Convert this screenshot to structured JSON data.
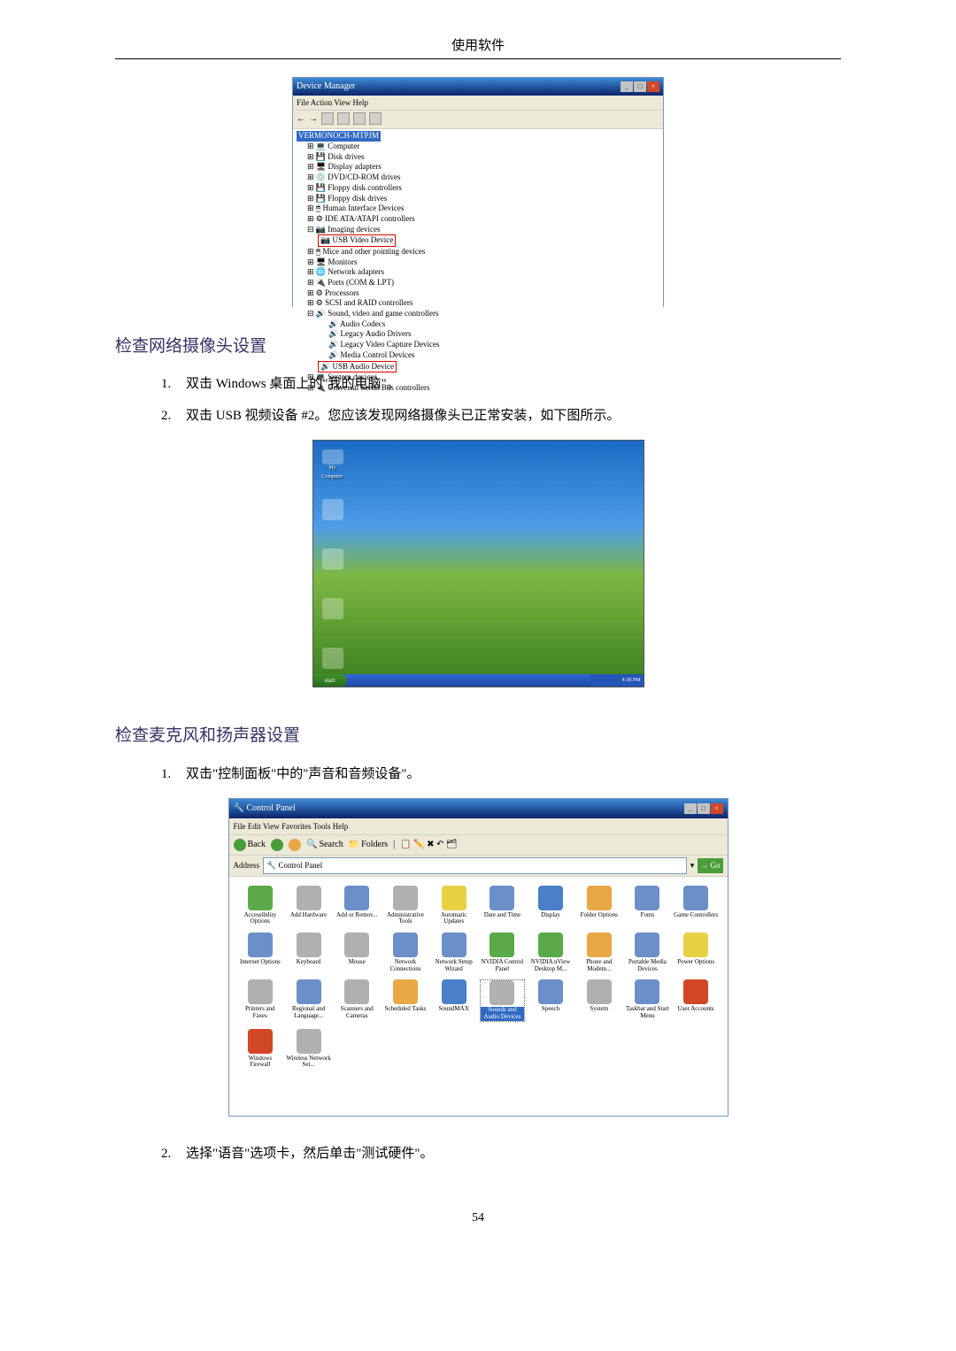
{
  "page_header": "使用软件",
  "page_number": "54",
  "device_manager": {
    "title": "Device Manager",
    "menu": "File   Action   View   Help",
    "tree_root": "VERMONOCH-MTPJM",
    "tree_items": [
      "Computer",
      "Disk drives",
      "Display adapters",
      "DVD/CD-ROM drives",
      "Floppy disk controllers",
      "Floppy disk drives",
      "Human Interface Devices",
      "IDE ATA/ATAPI controllers",
      "Imaging devices"
    ],
    "highlight1": "USB Video Device",
    "tree_items2": [
      "Mice and other pointing devices",
      "Monitors",
      "Network adapters",
      "Ports (COM & LPT)",
      "Processors",
      "SCSI and RAID controllers",
      "Sound, video and game controllers"
    ],
    "sound_sub": [
      "Audio Codecs",
      "Legacy Audio Drivers",
      "Legacy Video Capture Devices",
      "Media Control Devices"
    ],
    "highlight2": "USB Audio Device",
    "tree_items3": [
      "System devices",
      "Universal Serial Bus controllers"
    ]
  },
  "section1_heading": "检查网络摄像头设置",
  "section1_steps": [
    {
      "num": "1.",
      "text": "双击 Windows 桌面上的\"我的电脑\"。"
    },
    {
      "num": "2.",
      "text": "双击 USB 视频设备 #2。您应该发现网络摄像头已正常安装，如下图所示。"
    }
  ],
  "desktop": {
    "icons": [
      "My Computer",
      "",
      "",
      "",
      "",
      ""
    ],
    "start": "start",
    "time": "4:38 PM"
  },
  "section2_heading": "检查麦克风和扬声器设置",
  "section2_steps": [
    {
      "num": "1.",
      "text": "双击\"控制面板\"中的\"声音和音频设备\"。"
    },
    {
      "num": "2.",
      "text": "选择\"语音\"选项卡，然后单击\"测试硬件\"。"
    }
  ],
  "control_panel": {
    "title": "Control Panel",
    "menu": "File   Edit   View   Favorites   Tools   Help",
    "back": "Back",
    "search": "Search",
    "folders": "Folders",
    "address_label": "Address",
    "address_value": "Control Panel",
    "go": "Go",
    "items": [
      "Accessibility Options",
      "Add Hardware",
      "Add or Remov...",
      "Administrative Tools",
      "Automatic Updates",
      "Date and Time",
      "Display",
      "Folder Options",
      "Fonts",
      "Game Controllers",
      "Internet Options",
      "Keyboard",
      "Mouse",
      "Network Connections",
      "Network Setup Wizard",
      "NVIDIA Control Panel",
      "NVIDIA nView Desktop M...",
      "Phone and Modem...",
      "Portable Media Devices",
      "Power Options",
      "Printers and Faxes",
      "Regional and Language...",
      "Scanners and Cameras",
      "Scheduled Tasks",
      "SoundMAX",
      "Sounds and Audio Devices",
      "Speech",
      "System",
      "Taskbar and Start Menu",
      "User Accounts",
      "Windows Firewall",
      "Wireless Network Set..."
    ]
  }
}
